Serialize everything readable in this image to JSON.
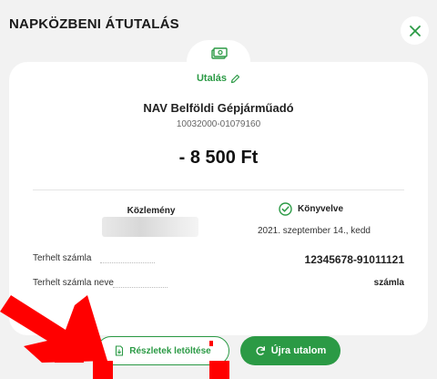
{
  "header": {
    "title": "NAPKÖZBENI ÁTUTALÁS"
  },
  "transfer": {
    "type_label": "Utalás",
    "payee": "NAV Belföldi Gépjárműadó",
    "account": "10032000-01079160",
    "amount": "- 8 500 Ft"
  },
  "details": {
    "memo_label": "Közlemény",
    "status_label": "Könyvelve",
    "status_date": "2021. szeptember 14., kedd",
    "debit_account_label": "Terhelt számla",
    "debit_account_value": "12345678-91011121",
    "debit_account_name_label": "Terhelt számla neve",
    "debit_account_name_value": "számla"
  },
  "actions": {
    "download_label": "Részletek letöltése",
    "retransfer_label": "Újra utalom"
  },
  "colors": {
    "accent": "#2b9a45",
    "annotation": "#ff0000"
  },
  "icons": [
    "close-icon",
    "money-icon",
    "pencil-icon",
    "check-circle-icon",
    "document-icon",
    "refresh-icon"
  ]
}
